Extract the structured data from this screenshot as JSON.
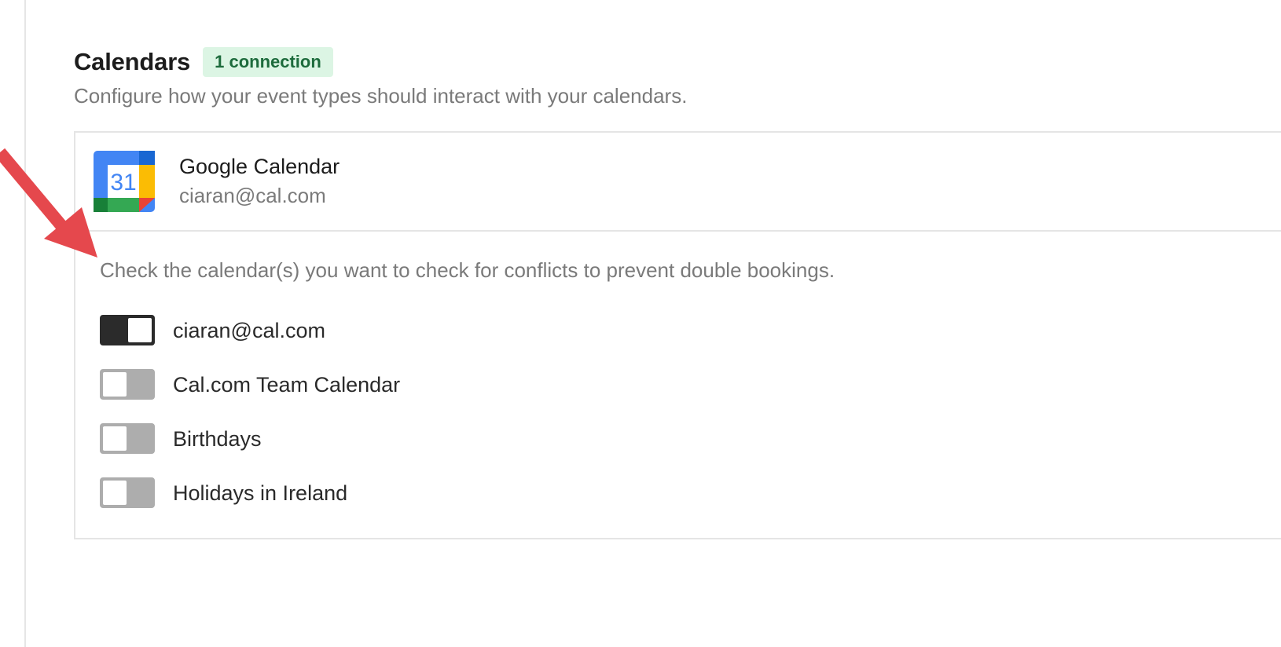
{
  "section": {
    "title": "Calendars",
    "badge": "1 connection",
    "description": "Configure how your event types should interact with your calendars."
  },
  "integration": {
    "name": "Google Calendar",
    "account": "ciaran@cal.com",
    "icon": "google-calendar-icon",
    "icon_day": "31"
  },
  "conflict_check": {
    "hint": "Check the calendar(s) you want to check for conflicts to prevent double bookings.",
    "calendars": [
      {
        "label": "ciaran@cal.com",
        "checked": true
      },
      {
        "label": "Cal.com Team Calendar",
        "checked": false
      },
      {
        "label": "Birthdays",
        "checked": false
      },
      {
        "label": "Holidays in Ireland",
        "checked": false
      }
    ]
  },
  "colors": {
    "badge_bg": "#dcf5e4",
    "badge_text": "#1d6b3c",
    "toggle_on": "#2b2b2b",
    "toggle_off": "#adadad",
    "annotation_arrow": "#e5484d"
  }
}
